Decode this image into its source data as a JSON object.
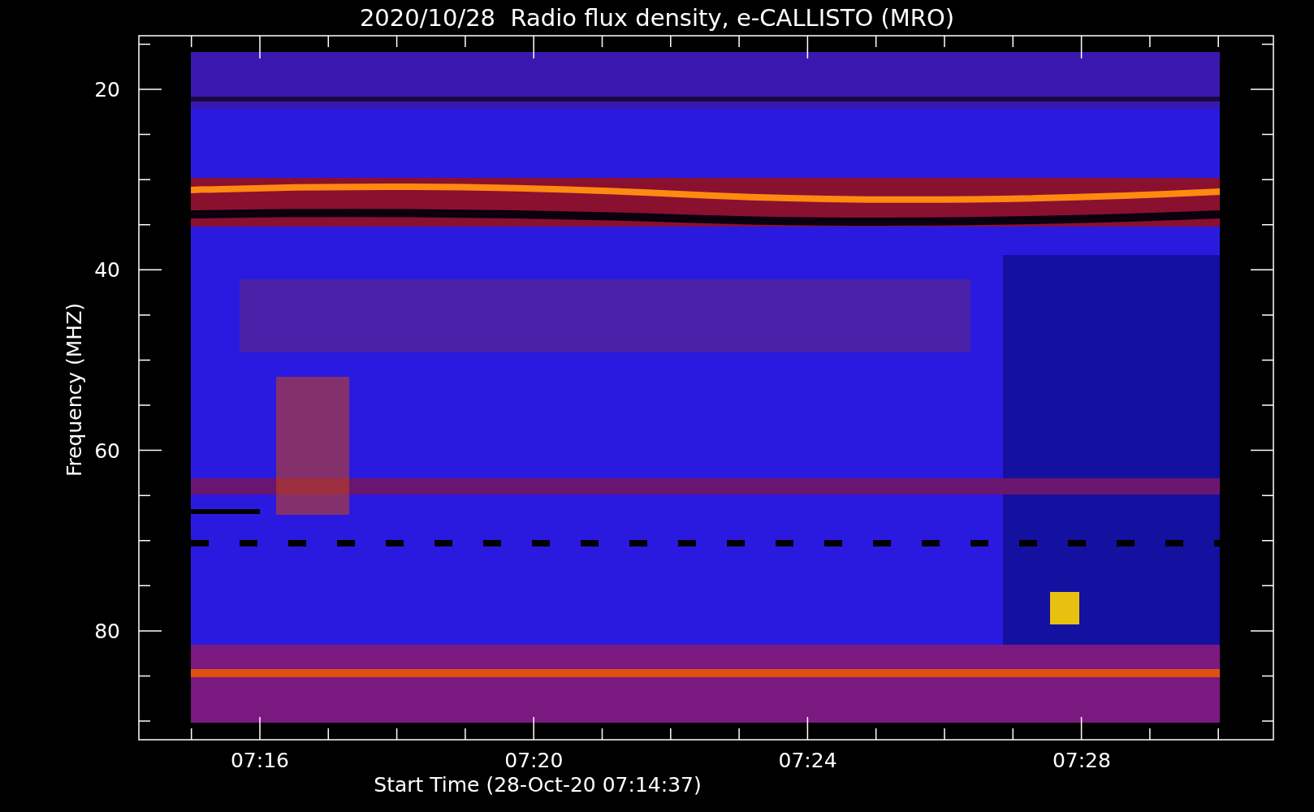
{
  "title": "2020/10/28  Radio flux density, e-CALLISTO (MRO)",
  "y_axis": {
    "label": "Frequency (MHZ)",
    "ticks": [
      "20",
      "40",
      "60",
      "80"
    ]
  },
  "x_axis": {
    "label": "Start Time (28-Oct-20 07:14:37)",
    "ticks": [
      "07:16",
      "07:20",
      "07:24",
      "07:28"
    ]
  }
}
